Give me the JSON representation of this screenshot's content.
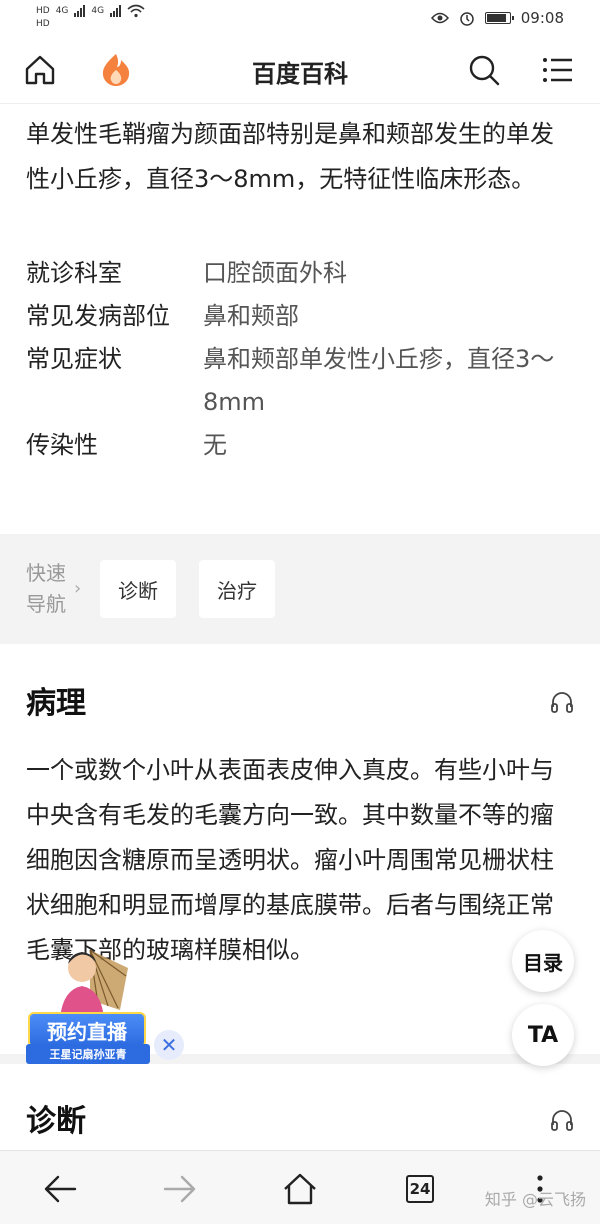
{
  "status_bar": {
    "sim1": "HD",
    "sim2": "HD",
    "net1": "4G",
    "net2": "4G",
    "time": "09:08"
  },
  "header": {
    "title": "百度百科"
  },
  "intro": {
    "text": "单发性毛鞘瘤为颜面部特别是鼻和颊部发生的单发性小丘疹，直径3～8mm，无特征性临床形态。"
  },
  "info": {
    "rows": [
      {
        "key": "就诊科室",
        "value": "口腔颌面外科"
      },
      {
        "key": "常见发病部位",
        "value": "鼻和颊部"
      },
      {
        "key": "常见症状",
        "value": "鼻和颊部单发性小丘疹，直径3～8mm"
      },
      {
        "key": "传染性",
        "value": "无"
      }
    ]
  },
  "quick_nav": {
    "label": "快速导航",
    "items": [
      "诊断",
      "治疗"
    ]
  },
  "sections": {
    "pathology": {
      "title": "病理",
      "body": "一个或数个小叶从表面表皮伸入真皮。有些小叶与中央含有毛发的毛囊方向一致。其中数量不等的瘤细胞因含糖原而呈透明状。瘤小叶周围常见栅状柱状细胞和明显而增厚的基底膜带。后者与围绕正常毛囊下部的玻璃样膜相似。"
    },
    "diagnosis": {
      "title": "诊断"
    }
  },
  "floating": {
    "toc_label": "目录",
    "ta_label": "TA"
  },
  "promo": {
    "title": "预约直播",
    "subtitle": "王星记扇孙亚青"
  },
  "bottom_bar": {
    "tab_count": "24"
  },
  "watermark": "知乎 @云飞扬",
  "colors": {
    "accent_orange": "#f5813f",
    "promo_blue": "#2c6be0"
  }
}
